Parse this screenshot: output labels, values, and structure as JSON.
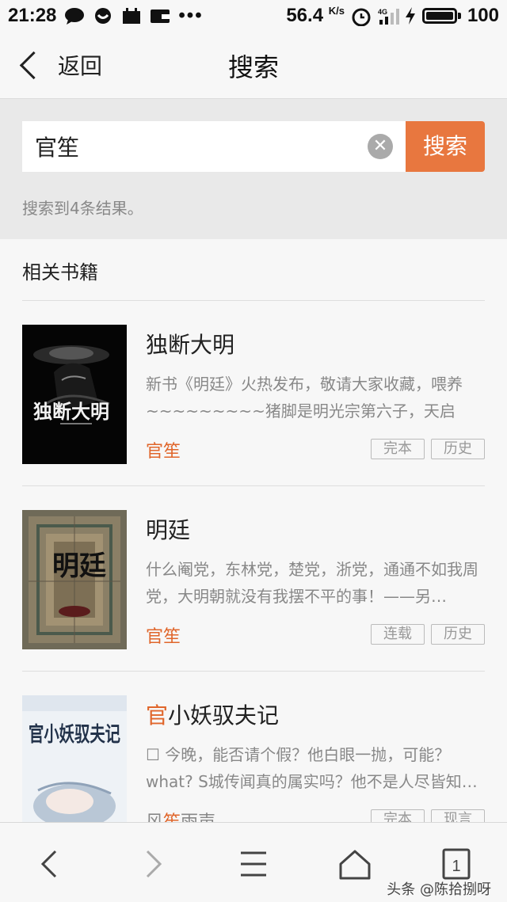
{
  "status_bar": {
    "time": "21:28",
    "network_speed": "56.4",
    "speed_unit": "K/s",
    "signal": "4G",
    "battery": "100"
  },
  "header": {
    "back_label": "返回",
    "title": "搜索"
  },
  "search": {
    "query": "官笙",
    "button_label": "搜索",
    "result_text": "搜索到4条结果。"
  },
  "section": {
    "title": "相关书籍"
  },
  "books": [
    {
      "title": "独断大明",
      "description": "新书《明廷》火热发布，敬请大家收藏，喂养~~~~~~~~~猪脚是明光宗第六子，天启朱…",
      "author": "官笙",
      "tags": [
        "完本",
        "历史"
      ],
      "cover_text": "独断大明"
    },
    {
      "title": "明廷",
      "description": "什么阉党，东林党，楚党，浙党，通通不如我周党，大明朝就没有我摆不平的事！——另…",
      "author": "官笙",
      "tags": [
        "连载",
        "历史"
      ],
      "cover_text": "明廷"
    },
    {
      "title_highlight": "官",
      "title_rest": "小妖驭夫记",
      "description": "☐ 今晚，能否请个假？他白眼一抛，可能？what? S城传闻真的属实吗？他不是人尽皆知…",
      "author_pre": "风",
      "author_highlight": "笙",
      "author_post": "雨声",
      "tags": [
        "完本",
        "现言"
      ],
      "cover_text": "官小妖驭夫记"
    }
  ],
  "bottom_nav": {
    "tab_count": "1",
    "watermark": "头条 @陈拾捌呀"
  },
  "colors": {
    "accent": "#e8773f",
    "author": "#e0662b"
  }
}
